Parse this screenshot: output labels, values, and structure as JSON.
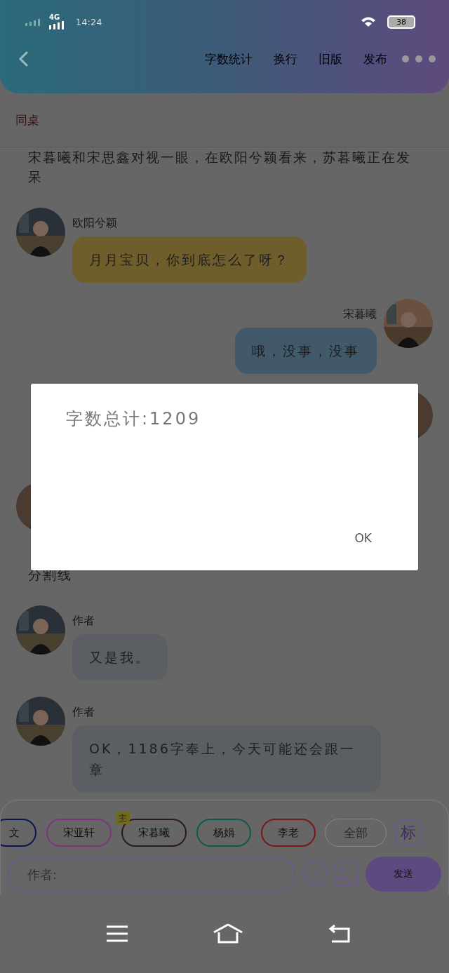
{
  "status_bar": {
    "network": "4G",
    "time": "14:24",
    "battery": "38"
  },
  "header": {
    "actions": [
      "字数统计",
      "换行",
      "旧版",
      "发布"
    ]
  },
  "section_title": "同桌",
  "messages": [
    {
      "kind": "narration",
      "text": "宋暮曦和宋思鑫对视一眼，在欧阳兮颖看来，苏暮曦正在发呆"
    },
    {
      "kind": "left",
      "sender": "欧阳兮颖",
      "text": "月月宝贝，你到底怎么了呀？",
      "color": "#6e5e2c"
    },
    {
      "kind": "right",
      "sender": "宋暮曦",
      "text": "哦，没事，没事",
      "color": "#42596a"
    },
    {
      "kind": "avatar-right"
    },
    {
      "kind": "avatar-left"
    },
    {
      "kind": "narration",
      "text": "分割线"
    },
    {
      "kind": "left",
      "sender": "作者",
      "text": "又是我。",
      "color": "#5b5f64"
    },
    {
      "kind": "left",
      "sender": "作者",
      "text": "OK，1186字奉上，今天可能还会跟一章",
      "color": "#5b5f64"
    }
  ],
  "roles": [
    {
      "name": "文",
      "color": "#0c1650"
    },
    {
      "name": "宋亚轩",
      "color": "#7e347c"
    },
    {
      "name": "宋暮曦",
      "color": "#2c1a16",
      "badge": "主"
    },
    {
      "name": "杨娟",
      "color": "#0e5a50"
    },
    {
      "name": "李老",
      "color": "#7a1818"
    }
  ],
  "all_button": "全部",
  "tag_button": "标",
  "input": {
    "placeholder": "作者:"
  },
  "send_button": "发送",
  "dialog": {
    "text": "字数总计:1209",
    "button": "OK"
  }
}
